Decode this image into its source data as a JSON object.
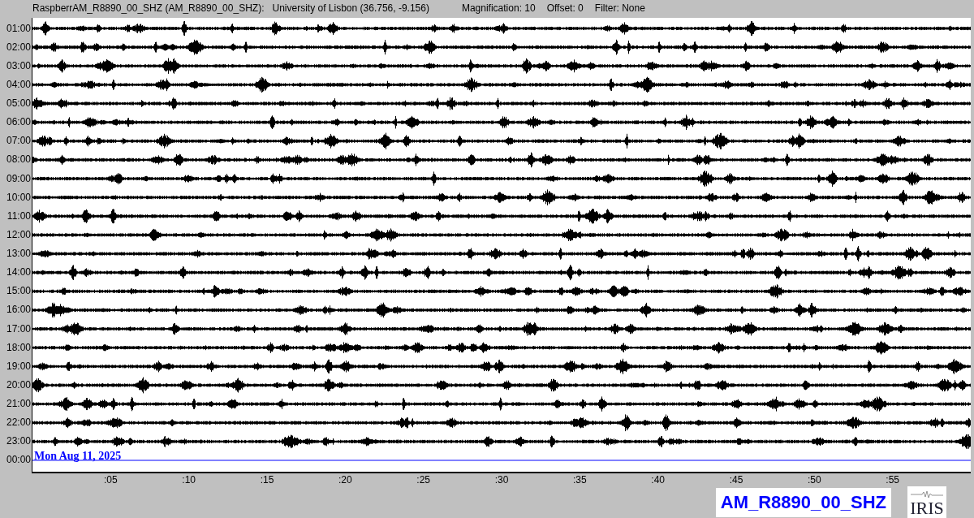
{
  "header": {
    "station": "RaspberrAM_R8890_00_SHZ (AM_R8890_00_SHZ):",
    "location": "University of Lisbon (36.756, -9.156)",
    "magnification": "Magnification: 10",
    "offset": "Offset: 0",
    "filter": "Filter: None"
  },
  "rows": [
    {
      "time": "01:00",
      "kind": "trace"
    },
    {
      "time": "02:00",
      "kind": "trace"
    },
    {
      "time": "03:00",
      "kind": "trace"
    },
    {
      "time": "04:00",
      "kind": "trace"
    },
    {
      "time": "05:00",
      "kind": "trace"
    },
    {
      "time": "06:00",
      "kind": "trace"
    },
    {
      "time": "07:00",
      "kind": "trace"
    },
    {
      "time": "08:00",
      "kind": "trace"
    },
    {
      "time": "09:00",
      "kind": "trace"
    },
    {
      "time": "10:00",
      "kind": "trace"
    },
    {
      "time": "11:00",
      "kind": "trace"
    },
    {
      "time": "12:00",
      "kind": "trace"
    },
    {
      "time": "13:00",
      "kind": "trace"
    },
    {
      "time": "14:00",
      "kind": "trace"
    },
    {
      "time": "15:00",
      "kind": "trace"
    },
    {
      "time": "16:00",
      "kind": "trace"
    },
    {
      "time": "17:00",
      "kind": "trace"
    },
    {
      "time": "18:00",
      "kind": "trace"
    },
    {
      "time": "19:00",
      "kind": "trace"
    },
    {
      "time": "20:00",
      "kind": "trace"
    },
    {
      "time": "21:00",
      "kind": "trace"
    },
    {
      "time": "22:00",
      "kind": "trace"
    },
    {
      "time": "23:00",
      "kind": "trace"
    },
    {
      "time": "00:00",
      "kind": "current"
    }
  ],
  "date": "Mon Aug 11, 2025",
  "minute_ticks": [
    ":05",
    ":10",
    ":15",
    ":20",
    ":25",
    ":30",
    ":35",
    ":40",
    ":45",
    ":50",
    ":55"
  ],
  "station_label": "AM_R8890_00_SHZ",
  "logo": "IRIS"
}
